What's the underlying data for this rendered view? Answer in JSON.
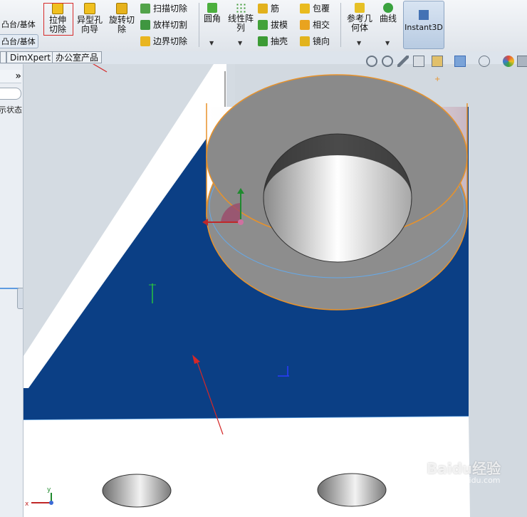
{
  "left_buttons": {
    "extrude_boss": "凸台/基体",
    "revolve_boss": "凸台/基体"
  },
  "ribbon": {
    "extruded_cut": "拉伸切除",
    "hole_wizard": "异型孔向导",
    "revolved_cut": "旋转切除",
    "swept_cut": "扫描切除",
    "lofted_cut": "放样切割",
    "boundary_cut": "边界切除",
    "fillet": "圆角",
    "linear_pattern": "线性阵列",
    "rib": "筋",
    "draft": "拔模",
    "shell": "抽壳",
    "wrap": "包覆",
    "intersect": "相交",
    "mirror": "镜向",
    "reference_geometry": "参考几何体",
    "curves": "曲线",
    "instant3d": "Instant3D"
  },
  "tabs": [
    "DimXpert",
    "办公室产品"
  ],
  "panel": {
    "collapse": "»",
    "display_state": "示状态"
  },
  "axes": {
    "x": "x",
    "y": "y"
  },
  "watermark": {
    "brand": "Baidu经验",
    "url": "jingyan.baidu.com"
  },
  "colors": {
    "face_blue": "#0b3f85",
    "highlight_orange": "#e8922a",
    "annotation_red": "#d42828"
  }
}
